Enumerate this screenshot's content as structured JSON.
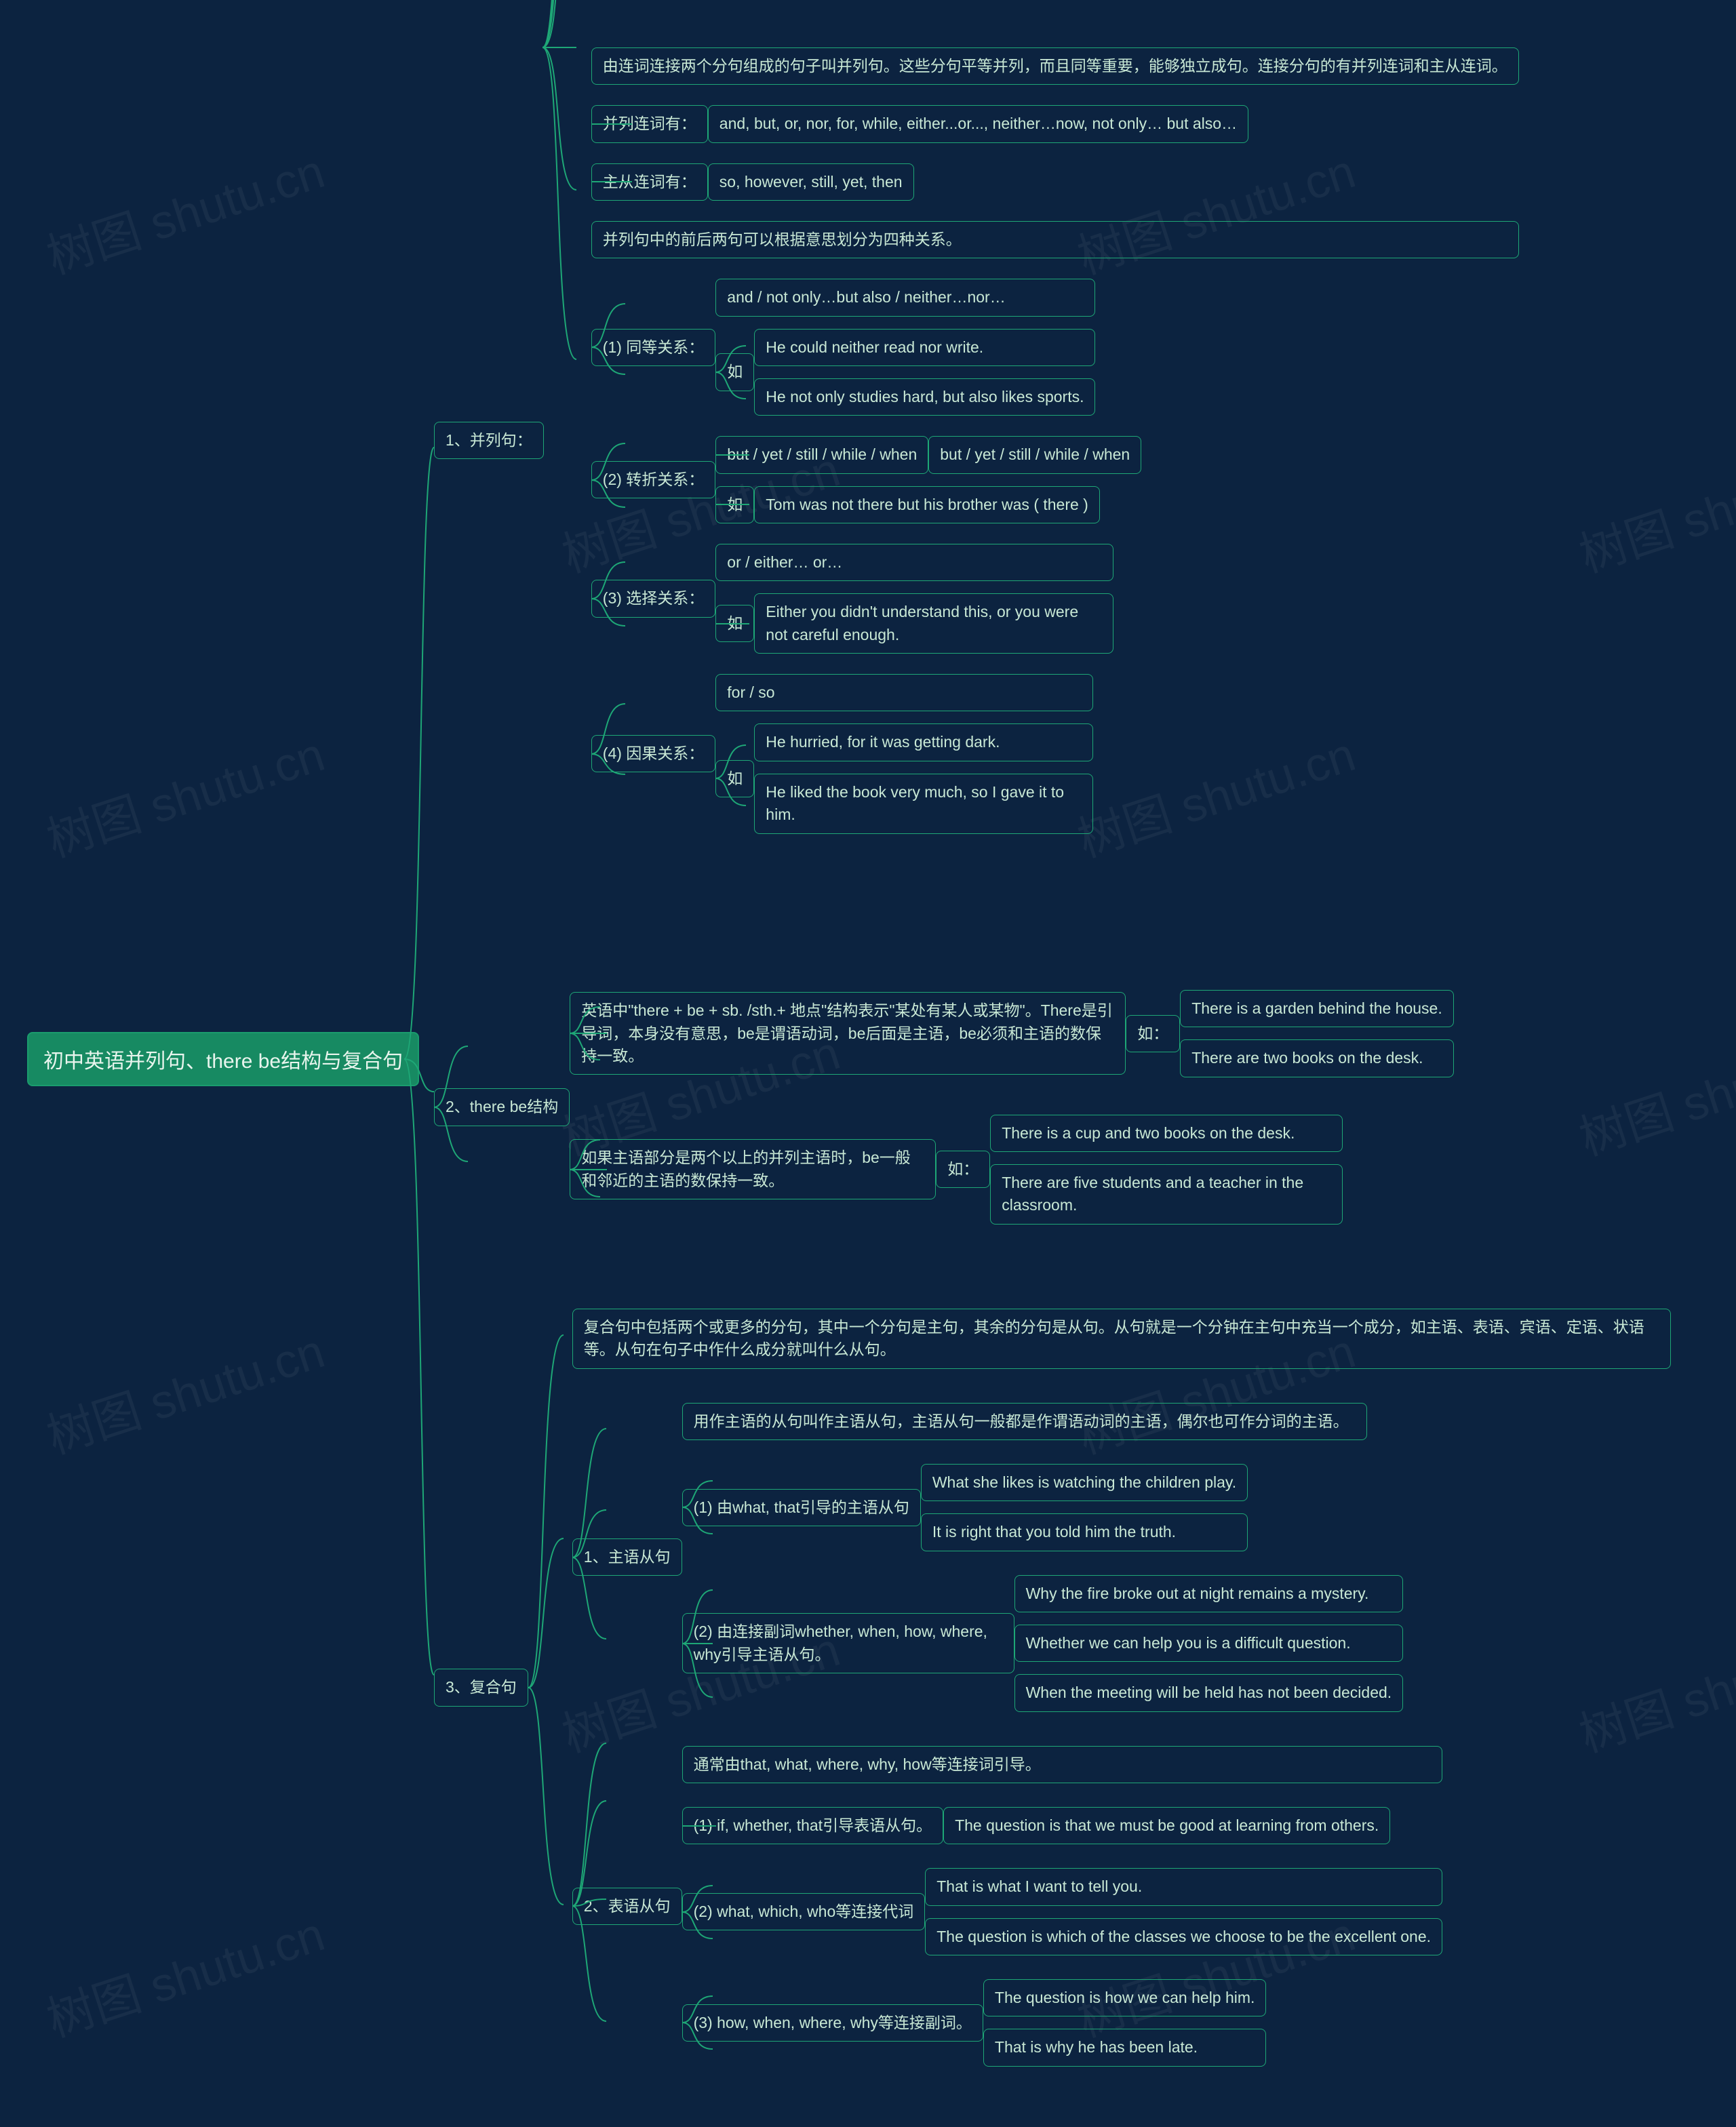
{
  "watermark": "树图 shutu.cn",
  "root": "初中英语并列句、there be结构与复合句",
  "s1": {
    "title": "1、并列句：",
    "intro": "由连词连接两个分句组成的句子叫并列句。这些分句平等并列，而且同等重要，能够独立成句。连接分句的有并列连词和主从连词。",
    "coord_label": "并列连词有：",
    "coord_list": "and, but, or, nor, for, while, either...or..., neither…now, not only… but also…",
    "sub_label": "主从连词有：",
    "sub_list": "so, however, still, yet, then",
    "relations_intro": "并列句中的前后两句可以根据意思划分为四种关系。",
    "r1": {
      "title": "(1) 同等关系：",
      "words": "and / not only…but also / neither…nor…",
      "eg_label": "如",
      "eg1": "He could neither read nor write.",
      "eg2": "He not only studies hard, but also likes sports."
    },
    "r2": {
      "title": "(2) 转折关系：",
      "words": "but / yet / still / while / when",
      "words2": "but / yet / still / while / when",
      "eg_label": "如",
      "eg1": "Tom was not there but his brother was ( there )"
    },
    "r3": {
      "title": "(3) 选择关系：",
      "words": "or / either… or…",
      "eg_label": "如",
      "eg1": "Either you didn't understand this, or you were not careful enough."
    },
    "r4": {
      "title": "(4) 因果关系：",
      "words": "for / so",
      "eg_label": "如",
      "eg1": "He hurried, for it was getting dark.",
      "eg2": "He liked the book very much, so I gave it to him."
    }
  },
  "s2": {
    "title": "2、there be结构",
    "p1": "英语中\"there + be + sb. /sth.+ 地点\"结构表示\"某处有某人或某物\"。There是引导词，本身没有意思，be是谓语动词，be后面是主语，be必须和主语的数保持一致。",
    "p1_eg_label": "如：",
    "p1_eg1": "There is a garden behind the house.",
    "p1_eg2": "There are two books on the desk.",
    "p2": "如果主语部分是两个以上的并列主语时，be一般和邻近的主语的数保持一致。",
    "p2_eg_label": "如：",
    "p2_eg1": "There is a cup and two books on the desk.",
    "p2_eg2": "There are five students and a teacher in the classroom."
  },
  "s3": {
    "title": "3、复合句",
    "intro": "复合句中包括两个或更多的分句，其中一个分句是主句，其余的分句是从句。从句就是一个分钟在主句中充当一个成分，如主语、表语、宾语、定语、状语等。从句在句子中作什么成分就叫什么从句。",
    "c1": {
      "title": "1、主语从句",
      "intro": "用作主语的从句叫作主语从句，主语从句一般都是作谓语动词的主语，偶尔也可作分词的主语。",
      "a_title": "(1) 由what, that引导的主语从句",
      "a_eg1": "What she likes is watching the children play.",
      "a_eg2": "It is right that you told him the truth.",
      "b_title": "(2) 由连接副词whether, when, how, where, why引导主语从句。",
      "b_eg1": "Why the fire broke out at night remains a mystery.",
      "b_eg2": "Whether we can help you is a difficult question.",
      "b_eg3": "When the meeting will be held has not been decided."
    },
    "c2": {
      "title": "2、表语从句",
      "intro": "通常由that, what, where, why, how等连接词引导。",
      "a_title": "(1) if, whether, that引导表语从句。",
      "a_eg1": "The question is that we must be good at learning from others.",
      "b_title": "(2) what, which, who等连接代词",
      "b_eg1": "That is what I want to tell you.",
      "b_eg2": "The question is which of the classes we choose to be the excellent one.",
      "c_title": "(3) how, when, where, why等连接副词。",
      "c_eg1": "The question is how we can help him.",
      "c_eg2": "That is why he has been late."
    }
  }
}
